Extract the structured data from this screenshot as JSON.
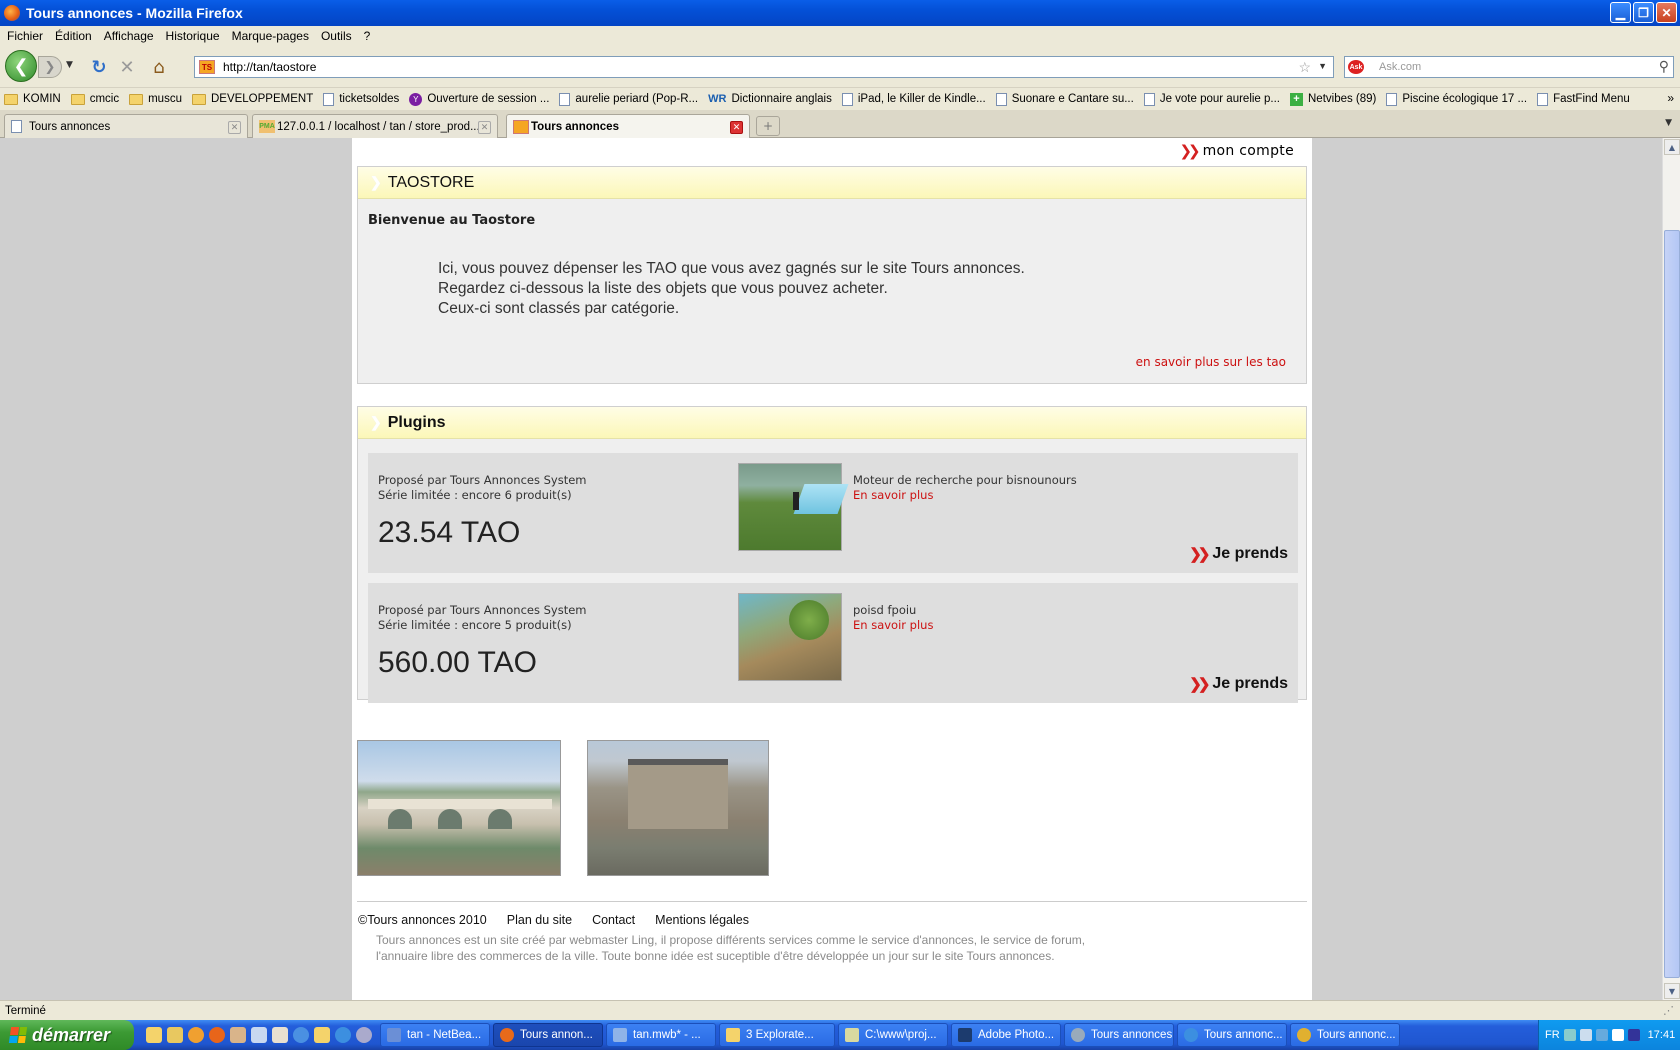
{
  "window": {
    "title": "Tours annonces - Mozilla Firefox"
  },
  "menu": [
    "Fichier",
    "Édition",
    "Affichage",
    "Historique",
    "Marque-pages",
    "Outils",
    "?"
  ],
  "nav": {
    "url": "http://tan/taostore",
    "site_icon_text": "TS",
    "search_placeholder": "Ask.com",
    "ask_icon_text": "Ask"
  },
  "bookmarks": [
    {
      "label": "KOMIN",
      "icon": "folder"
    },
    {
      "label": "cmcic",
      "icon": "folder"
    },
    {
      "label": "muscu",
      "icon": "folder"
    },
    {
      "label": "DEVELOPPEMENT",
      "icon": "folder"
    },
    {
      "label": "ticketsoldes",
      "icon": "page"
    },
    {
      "label": "Ouverture de session ...",
      "icon": "yahoo"
    },
    {
      "label": "aurelie periard (Pop-R...",
      "icon": "page"
    },
    {
      "label": "Dictionnaire anglais",
      "icon": "wr"
    },
    {
      "label": "iPad, le Killer de Kindle...",
      "icon": "page"
    },
    {
      "label": "Suonare e Cantare su...",
      "icon": "page"
    },
    {
      "label": "Je vote pour aurelie p...",
      "icon": "page"
    },
    {
      "label": "Netvibes (89)",
      "icon": "plus"
    },
    {
      "label": "Piscine écologique 17 ...",
      "icon": "page"
    },
    {
      "label": "FastFind Menu",
      "icon": "page"
    }
  ],
  "tabs": [
    {
      "label": "Tours annonces"
    },
    {
      "label": "127.0.0.1 / localhost / tan / store_prod..."
    },
    {
      "label": "Tours annonces"
    }
  ],
  "page": {
    "account_link": "mon compte",
    "store": {
      "title": "TAOSTORE",
      "welcome": "Bienvenue au Taostore",
      "intro": [
        "Ici, vous pouvez dépenser les TAO que vous avez gagnés sur le site Tours annonces.",
        "Regardez ci-dessous la liste des objets que vous pouvez acheter.",
        "Ceux-ci sont classés par catégorie."
      ],
      "more_link": "en savoir plus sur les tao"
    },
    "plugins": {
      "title": "Plugins",
      "products": [
        {
          "by": "Proposé par Tours Annonces System",
          "stock": "Série limitée : encore 6 produit(s)",
          "price": "23.54 TAO",
          "name": "Moteur de recherche pour bisnounours",
          "more": "En savoir plus",
          "take": "Je prends"
        },
        {
          "by": "Proposé par Tours Annonces System",
          "stock": "Série limitée : encore 5 produit(s)",
          "price": "560.00 TAO",
          "name": "poisd fpoiu",
          "more": "En savoir plus",
          "take": "Je prends"
        }
      ]
    },
    "footer": {
      "links": [
        "©Tours annonces 2010",
        "Plan du site",
        "Contact",
        "Mentions légales"
      ],
      "text": "Tours annonces est un site créé par webmaster Ling, il propose différents services comme le service d'annonces, le service de forum, l'annuaire libre des commerces de la ville. Toute bonne idée est suceptible d'être développée un jour sur le site Tours annonces."
    }
  },
  "status": {
    "text": "Terminé"
  },
  "taskbar": {
    "start": "démarrer",
    "buttons": [
      {
        "label": "tan - NetBea...",
        "color": "#6b8fd6"
      },
      {
        "label": "Tours annon...",
        "color": "#e86a1a"
      },
      {
        "label": "tan.mwb* - ...",
        "color": "#8fb3e8"
      },
      {
        "label": "3 Explorate...",
        "color": "#f4d36b"
      },
      {
        "label": "C:\\www\\proj...",
        "color": "#d9d9a0"
      },
      {
        "label": "Adobe Photo...",
        "color": "#1c3b6e"
      },
      {
        "label": "Tours annonces",
        "color": "#9ab"
      },
      {
        "label": "Tours annonc...",
        "color": "#3c8fe0"
      },
      {
        "label": "Tours annonc...",
        "color": "#e0b030"
      }
    ],
    "lang": "FR",
    "clock": "17:41"
  }
}
